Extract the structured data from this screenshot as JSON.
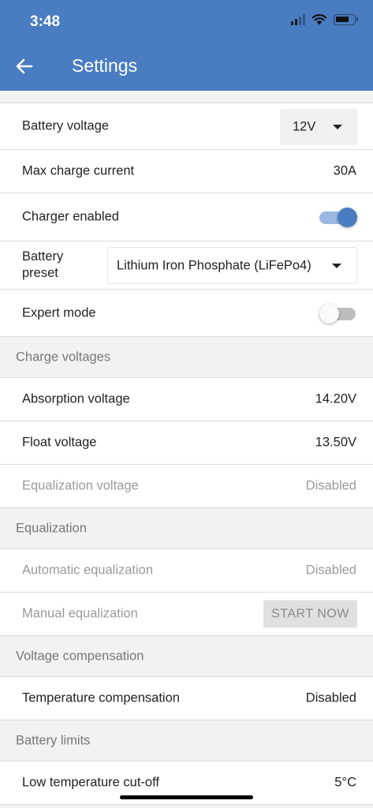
{
  "status_bar": {
    "time": "3:48"
  },
  "header": {
    "title": "Settings",
    "back_icon": "arrow-left-icon"
  },
  "colors": {
    "header_bg": "#4a7cc2",
    "toggle_on": "#4a7cc2",
    "toggle_on_track": "#9bb7e2",
    "toggle_off_thumb": "#fafafa",
    "toggle_off_track": "#bdbdbd"
  },
  "general": {
    "battery_voltage": {
      "label": "Battery voltage",
      "value": "12V"
    },
    "max_charge_current": {
      "label": "Max charge current",
      "value": "30A"
    },
    "charger_enabled": {
      "label": "Charger enabled",
      "on": true
    },
    "battery_preset": {
      "label_line1": "Battery",
      "label_line2": "preset",
      "value": "Lithium Iron Phosphate (LiFePo4)"
    },
    "expert_mode": {
      "label": "Expert mode",
      "on": false
    }
  },
  "charge_voltages": {
    "header": "Charge voltages",
    "absorption": {
      "label": "Absorption voltage",
      "value": "14.20V"
    },
    "float": {
      "label": "Float voltage",
      "value": "13.50V"
    },
    "equalization": {
      "label": "Equalization voltage",
      "value": "Disabled"
    }
  },
  "equalization": {
    "header": "Equalization",
    "automatic": {
      "label": "Automatic equalization",
      "value": "Disabled"
    },
    "manual": {
      "label": "Manual equalization",
      "button": "START NOW"
    }
  },
  "voltage_compensation": {
    "header": "Voltage compensation",
    "temperature": {
      "label": "Temperature compensation",
      "value": "Disabled"
    }
  },
  "battery_limits": {
    "header": "Battery limits",
    "low_temp": {
      "label": "Low temperature cut-off",
      "value": "5°C"
    }
  }
}
